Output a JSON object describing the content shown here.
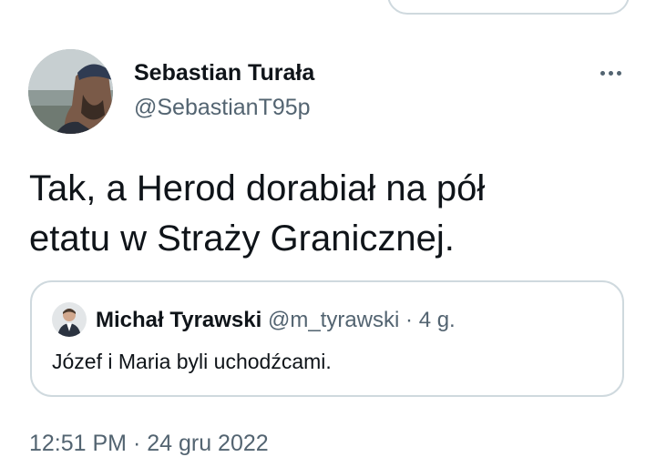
{
  "tweet": {
    "author": {
      "name": "Sebastian Turała",
      "handle": "@SebastianT95p"
    },
    "line1": "Tak, a Herod dorabiał na pół",
    "line2": "etatu w Straży Granicznej.",
    "timestamp": "12:51 PM · 24 gru 2022"
  },
  "quoted": {
    "name": "Michał Tyrawski",
    "handle": "@m_tyrawski",
    "separator": "·",
    "time": "4 g.",
    "text": "Józef i Maria byli uchodźcami."
  },
  "icons": {
    "more": "more-horizontal-icon"
  },
  "colors": {
    "primary_text": "#0f1419",
    "secondary_text": "#536471",
    "border": "#cfd9de",
    "background": "#ffffff"
  }
}
